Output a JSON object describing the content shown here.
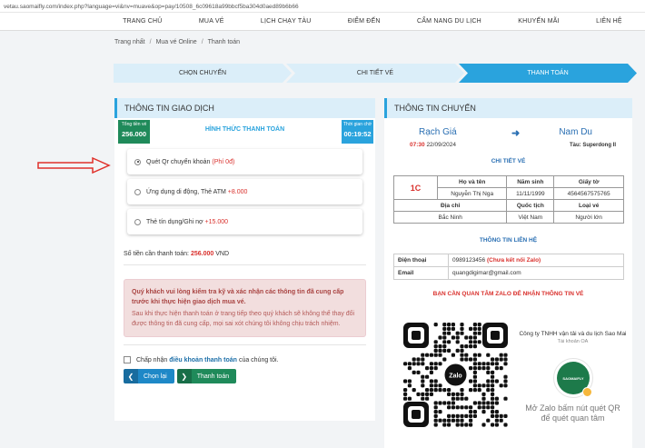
{
  "url": "vetau.saomaifly.com/index.php?language=vi&nv=muave&op=pay/10508_6c09618a99bbcf5ba304d0aed89b6b66",
  "nav": [
    "TRANG CHỦ",
    "MUA VÉ",
    "LỊCH CHẠY TÀU",
    "ĐIỂM ĐẾN",
    "CẨM NANG DU LỊCH",
    "KHUYẾN MÃI",
    "LIÊN HỆ"
  ],
  "breadcrumb": [
    "Trang nhất",
    "Mua vé Online",
    "Thanh toán"
  ],
  "steps": [
    "CHỌN CHUYẾN",
    "CHI TIẾT VÉ",
    "THANH TOÁN"
  ],
  "left": {
    "title": "THÔNG TIN GIAO DỊCH",
    "total_label": "Tổng tiền vé",
    "total_value": "256.000",
    "time_label": "Thời gian chờ",
    "time_value": "00:19:52",
    "pay_title": "HÌNH THỨC THANH TOÁN",
    "options": [
      {
        "label": "Quét Qr chuyển khoản",
        "fee": "(Phí 0đ)",
        "selected": true
      },
      {
        "label": "Ứng dụng di động, Thẻ ATM",
        "fee": "+8.000",
        "selected": false
      },
      {
        "label": "Thẻ tín dụng/Ghi nợ",
        "fee": "+15.000",
        "selected": false
      }
    ],
    "amount_label": "Số tiền cần thanh toán:",
    "amount_value": "256.000",
    "amount_unit": "VND",
    "alert_strong": "Quý khách vui lòng kiểm tra kỹ và xác nhận các thông tin đã cung cấp trước khi thực hiện giao dịch mua vé.",
    "alert_body": "Sau khi thực hiện thanh toán ở trang tiếp theo quý khách sẽ không thể thay đổi được thông tin đã cung cấp, mọi sai xót chúng tôi không chịu trách nhiệm.",
    "agree_pre": "Chấp nhận",
    "agree_link": "điều khoản thanh toán",
    "agree_post": "của chúng tôi.",
    "back_label": "Chọn lại",
    "next_label": "Thanh toán"
  },
  "right": {
    "title": "THÔNG TIN CHUYẾN",
    "from": "Rạch Giá",
    "to": "Nam Du",
    "time": "07:30",
    "date": "22/09/2024",
    "ship": "Tàu: Superdong II",
    "ticket_title": "CHI TIẾT VÉ",
    "seat": "1C",
    "h_name": "Họ và tên",
    "h_year": "Năm sinh",
    "h_id": "Giấy tờ",
    "name": "Nguyễn Thị Nga",
    "year": "11/11/1999",
    "id": "4564567575765",
    "h_addr": "Địa chỉ",
    "h_nat": "Quốc tịch",
    "h_type": "Loại vé",
    "addr": "Bắc Ninh",
    "nat": "Việt Nam",
    "type": "Người lớn",
    "contact_title": "THÔNG TIN LIÊN HỆ",
    "phone_label": "Điện thoại",
    "phone": "0989123456",
    "phone_note": "(Chưa kết nối Zalo)",
    "email_label": "Email",
    "email": "quangdigimar@gmail.com",
    "zalo_title": "BẠN CẦN QUAN TÂM ZALO ĐỂ NHẬN THÔNG TIN VÉ",
    "company": "Công ty TNHH vận tải  và du lịch Sao Mai",
    "oa": "Tài khoản OA",
    "qr_text": "Zalo",
    "logo_text": "SAOMAIFLY",
    "scan_1": "Mở Zalo bấm nút quét QR",
    "scan_2": "để quét quan tâm"
  },
  "colors": {
    "accent": "#2aa3dd",
    "green": "#1f8a5a",
    "red": "#d9302c",
    "navy": "#2a6fb3"
  }
}
